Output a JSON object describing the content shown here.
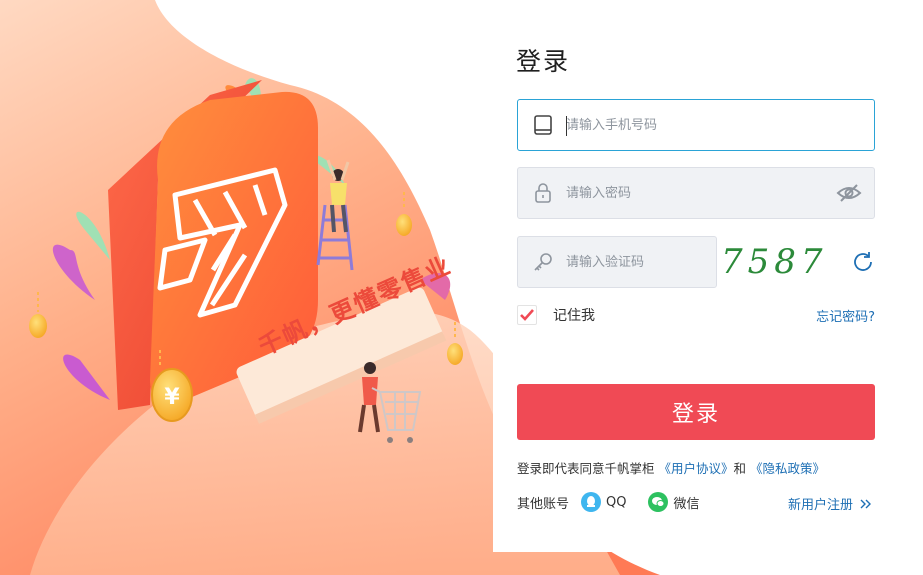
{
  "illustration": {
    "banner_text": "千帆，更懂零售业"
  },
  "login": {
    "title": "登录",
    "phone": {
      "placeholder": "请输入手机号码",
      "icon": "phone-icon"
    },
    "password": {
      "placeholder": "请输入密码",
      "icon": "lock-icon",
      "toggle_icon": "eye-hidden-icon"
    },
    "captcha": {
      "placeholder": "请输入验证码",
      "icon": "key-icon",
      "code": "7587",
      "refresh_icon": "refresh-icon"
    },
    "remember_label": "记住我",
    "remember_checked": true,
    "forgot_label": "忘记密码?",
    "submit_label": "登录",
    "agreement": {
      "prefix": "登录即代表同意千帆掌柜",
      "user_agreement": "《用户协议》",
      "conjunction": "和",
      "privacy_policy": "《隐私政策》"
    },
    "other_accounts": {
      "label": "其他账号",
      "qq": "QQ",
      "wechat": "微信"
    },
    "register_label": "新用户注册",
    "colors": {
      "accent": "#f04a55",
      "link": "#1e6fb4",
      "focus_border": "#2aa3d6",
      "captcha": "#2c8a3a"
    }
  }
}
